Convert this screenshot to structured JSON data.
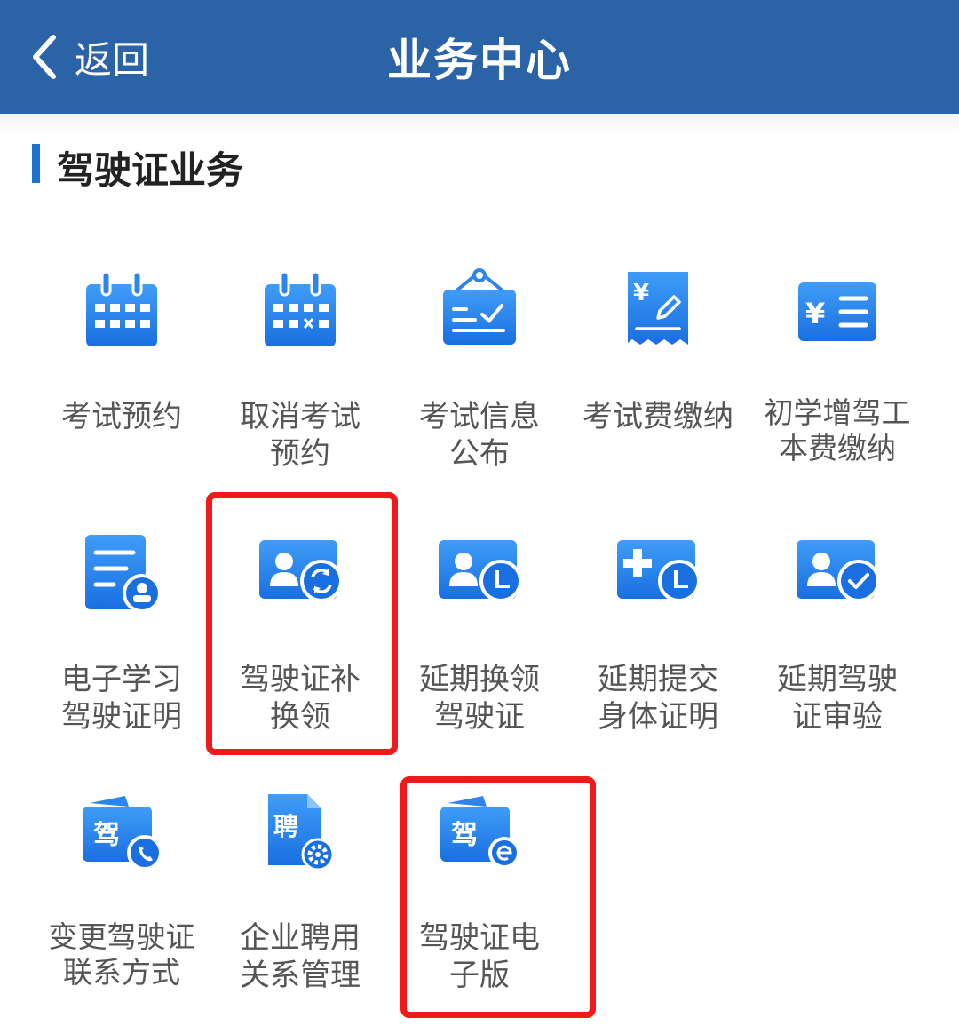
{
  "header": {
    "back_label": "返回",
    "title": "业务中心"
  },
  "section": {
    "title": "驾驶证业务"
  },
  "items": [
    {
      "label": "考试预约",
      "icon": "calendar-icon"
    },
    {
      "label": "取消考试\n预约",
      "icon": "calendar-cancel-icon"
    },
    {
      "label": "考试信息\n公布",
      "icon": "notice-board-icon"
    },
    {
      "label": "考试费缴纳",
      "icon": "receipt-yuan-icon"
    },
    {
      "label": "初学增驾工\n本费缴纳",
      "icon": "yuan-list-icon"
    },
    {
      "label": "电子学习\n驾驶证明",
      "icon": "document-user-icon"
    },
    {
      "label": "驾驶证补\n换领",
      "icon": "id-card-exchange-icon"
    },
    {
      "label": "延期换领\n驾驶证",
      "icon": "id-card-clock-icon"
    },
    {
      "label": "延期提交\n身体证明",
      "icon": "medical-card-clock-icon"
    },
    {
      "label": "延期驾驶\n证审验",
      "icon": "id-card-check-icon"
    },
    {
      "label": "变更驾驶证\n联系方式",
      "icon": "license-phone-icon"
    },
    {
      "label": "企业聘用\n关系管理",
      "icon": "hire-document-gear-icon"
    },
    {
      "label": "驾驶证电\n子版",
      "icon": "license-electronic-icon"
    }
  ],
  "icon_glyphs": {
    "license": "驾",
    "hire": "聘"
  },
  "colors": {
    "header": "#2a64a7",
    "accent": "#1e72cf",
    "highlight": "#f01a1a"
  }
}
